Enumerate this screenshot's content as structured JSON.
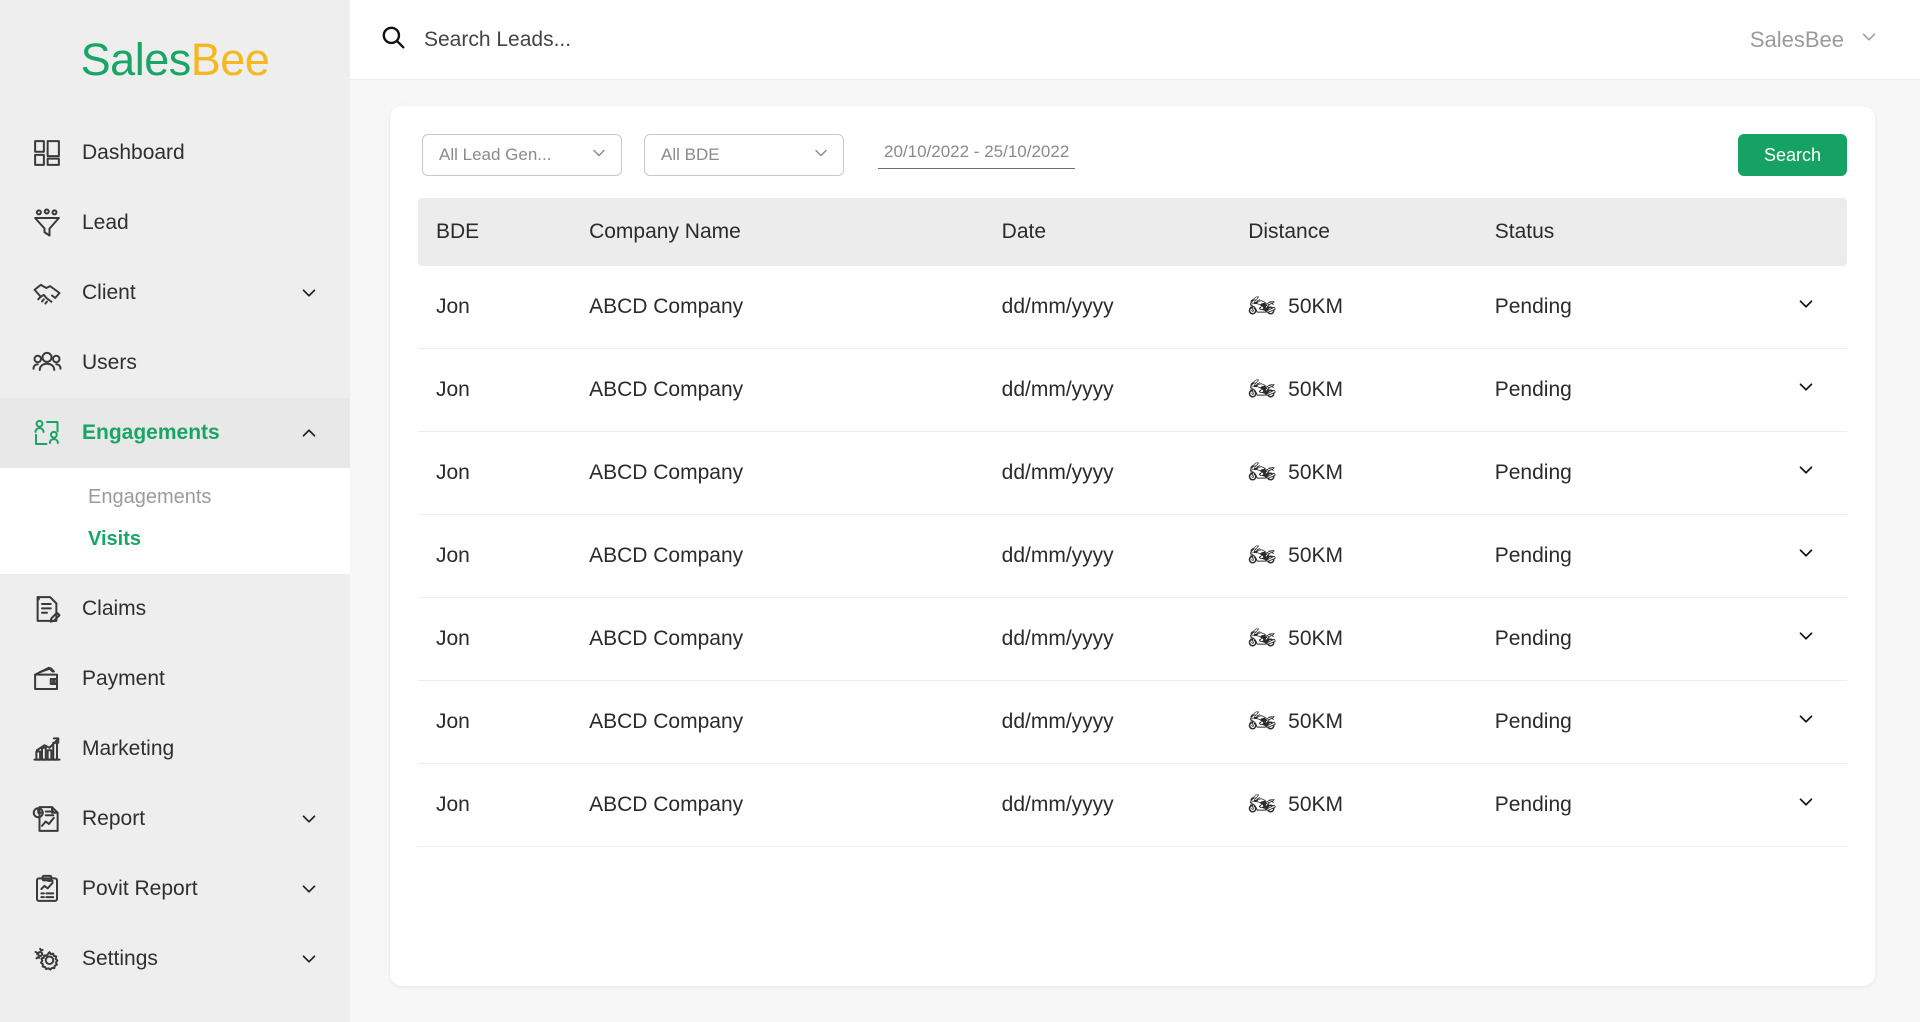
{
  "brand": {
    "name_green": "Sales",
    "name_yellow": "Bee",
    "accent_green": "#18a565",
    "accent_yellow": "#f6b821"
  },
  "sidebar": {
    "items": [
      {
        "label": "Dashboard",
        "icon": "dashboard-icon",
        "has_chevron": false,
        "active": false
      },
      {
        "label": "Lead",
        "icon": "funnel-icon",
        "has_chevron": false,
        "active": false
      },
      {
        "label": "Client",
        "icon": "handshake-icon",
        "has_chevron": true,
        "chevron": "chevron-down-icon",
        "active": false
      },
      {
        "label": "Users",
        "icon": "users-icon",
        "has_chevron": false,
        "active": false
      },
      {
        "label": "Engagements",
        "icon": "engagements-icon",
        "has_chevron": true,
        "chevron": "chevron-up-icon",
        "active": true
      },
      {
        "label": "Claims",
        "icon": "claims-icon",
        "has_chevron": false,
        "active": false
      },
      {
        "label": "Payment",
        "icon": "wallet-icon",
        "has_chevron": false,
        "active": false
      },
      {
        "label": "Marketing",
        "icon": "bar-chart-icon",
        "has_chevron": false,
        "active": false
      },
      {
        "label": "Report",
        "icon": "report-icon",
        "has_chevron": true,
        "chevron": "chevron-down-icon",
        "active": false
      },
      {
        "label": "Povit Report",
        "icon": "clipboard-icon",
        "has_chevron": true,
        "chevron": "chevron-down-icon",
        "active": false
      },
      {
        "label": "Settings",
        "icon": "gear-icon",
        "has_chevron": true,
        "chevron": "chevron-down-icon",
        "active": false
      }
    ],
    "submenu": {
      "parent": "Engagements",
      "items": [
        {
          "label": "Engagements",
          "active": false
        },
        {
          "label": "Visits",
          "active": true
        }
      ]
    }
  },
  "topbar": {
    "search_placeholder": "Search Leads...",
    "search_value": "",
    "search_icon": "search-icon",
    "user_name": "SalesBee",
    "user_chevron": "chevron-down-icon"
  },
  "filters": {
    "lead_gen": {
      "value": "All Lead Gen...",
      "chevron": "chevron-down-icon"
    },
    "bde": {
      "value": "All BDE",
      "chevron": "chevron-down-icon"
    },
    "date_range": "20/10/2022 - 25/10/2022",
    "search_button": "Search"
  },
  "table": {
    "columns": [
      "BDE",
      "Company Name",
      "Date",
      "Distance",
      "Status",
      ""
    ],
    "row_expand_icon": "chevron-down-icon",
    "rows": [
      {
        "bde": "Jon",
        "company": "ABCD Company",
        "date": "dd/mm/yyyy",
        "vehicle_icon": "motorcycle-icon",
        "distance": "50KM",
        "status": "Pending"
      },
      {
        "bde": "Jon",
        "company": "ABCD Company",
        "date": "dd/mm/yyyy",
        "vehicle_icon": "motorcycle-icon",
        "distance": "50KM",
        "status": "Pending"
      },
      {
        "bde": "Jon",
        "company": "ABCD Company",
        "date": "dd/mm/yyyy",
        "vehicle_icon": "motorcycle-icon",
        "distance": "50KM",
        "status": "Pending"
      },
      {
        "bde": "Jon",
        "company": "ABCD Company",
        "date": "dd/mm/yyyy",
        "vehicle_icon": "motorcycle-icon",
        "distance": "50KM",
        "status": "Pending"
      },
      {
        "bde": "Jon",
        "company": "ABCD Company",
        "date": "dd/mm/yyyy",
        "vehicle_icon": "motorcycle-icon",
        "distance": "50KM",
        "status": "Pending"
      },
      {
        "bde": "Jon",
        "company": "ABCD Company",
        "date": "dd/mm/yyyy",
        "vehicle_icon": "motorcycle-icon",
        "distance": "50KM",
        "status": "Pending"
      },
      {
        "bde": "Jon",
        "company": "ABCD Company",
        "date": "dd/mm/yyyy",
        "vehicle_icon": "motorcycle-icon",
        "distance": "50KM",
        "status": "Pending"
      }
    ]
  }
}
